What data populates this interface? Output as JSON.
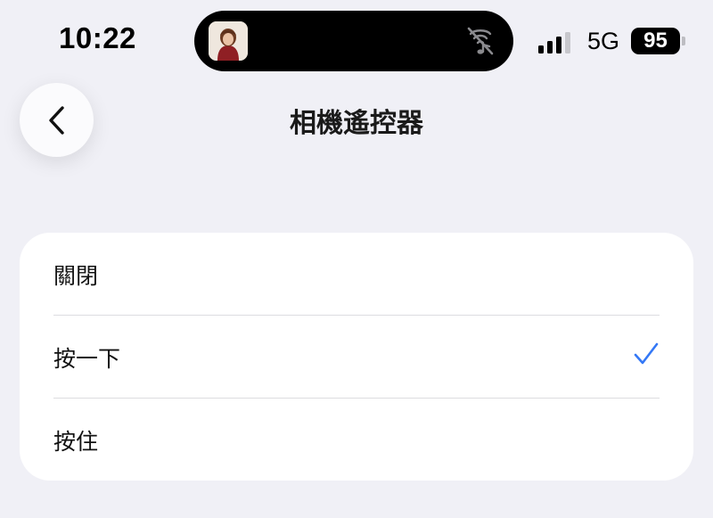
{
  "status_bar": {
    "time": "10:22",
    "network": "5G",
    "battery": "95",
    "island_icons": [
      "album-art-icon",
      "bell-slash-icon"
    ]
  },
  "header": {
    "back_icon": "chevron-left-icon",
    "title": "相機遙控器"
  },
  "options": [
    {
      "label": "關閉",
      "selected": false
    },
    {
      "label": "按一下",
      "selected": true
    },
    {
      "label": "按住",
      "selected": false
    }
  ],
  "colors": {
    "accent": "#3478f6",
    "background": "#f0f0f6",
    "card": "#ffffff"
  }
}
